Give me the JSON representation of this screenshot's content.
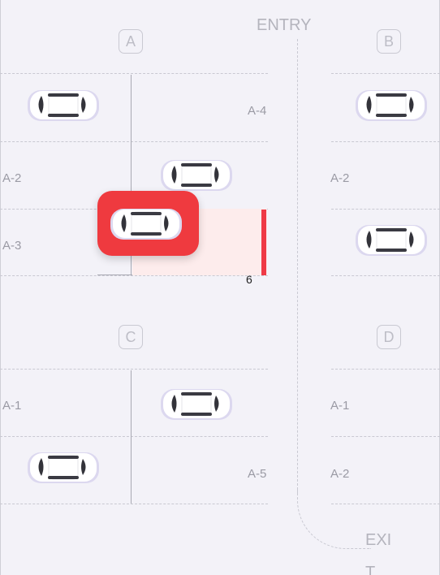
{
  "entry_label": "ENTRY",
  "exit_label": "EXIT",
  "zones": {
    "a": "A",
    "b": "B",
    "c": "C",
    "d": "D"
  },
  "spots": {
    "a4": "A-4",
    "a2_left": "A-2",
    "a3": "A-3",
    "a2_right": "A-2",
    "a1_left": "A-1",
    "a5": "A-5",
    "a1_right": "A-1",
    "a2_bottom": "A-2"
  },
  "selected_spot_number": "6",
  "colors": {
    "highlight": "#ef3a3f",
    "background": "#f3f2f8"
  },
  "icons": {
    "car": "car-top-view-icon"
  }
}
